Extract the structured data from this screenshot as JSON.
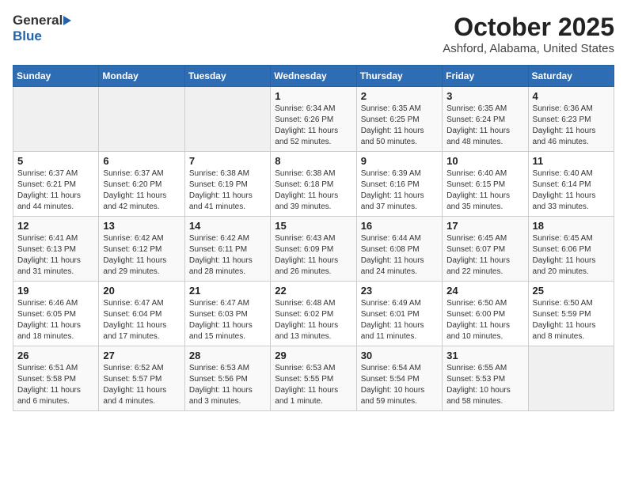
{
  "header": {
    "logo_general": "General",
    "logo_blue": "Blue",
    "month_title": "October 2025",
    "location": "Ashford, Alabama, United States"
  },
  "weekdays": [
    "Sunday",
    "Monday",
    "Tuesday",
    "Wednesday",
    "Thursday",
    "Friday",
    "Saturday"
  ],
  "weeks": [
    [
      {
        "day": "",
        "info": ""
      },
      {
        "day": "",
        "info": ""
      },
      {
        "day": "",
        "info": ""
      },
      {
        "day": "1",
        "info": "Sunrise: 6:34 AM\nSunset: 6:26 PM\nDaylight: 11 hours\nand 52 minutes."
      },
      {
        "day": "2",
        "info": "Sunrise: 6:35 AM\nSunset: 6:25 PM\nDaylight: 11 hours\nand 50 minutes."
      },
      {
        "day": "3",
        "info": "Sunrise: 6:35 AM\nSunset: 6:24 PM\nDaylight: 11 hours\nand 48 minutes."
      },
      {
        "day": "4",
        "info": "Sunrise: 6:36 AM\nSunset: 6:23 PM\nDaylight: 11 hours\nand 46 minutes."
      }
    ],
    [
      {
        "day": "5",
        "info": "Sunrise: 6:37 AM\nSunset: 6:21 PM\nDaylight: 11 hours\nand 44 minutes."
      },
      {
        "day": "6",
        "info": "Sunrise: 6:37 AM\nSunset: 6:20 PM\nDaylight: 11 hours\nand 42 minutes."
      },
      {
        "day": "7",
        "info": "Sunrise: 6:38 AM\nSunset: 6:19 PM\nDaylight: 11 hours\nand 41 minutes."
      },
      {
        "day": "8",
        "info": "Sunrise: 6:38 AM\nSunset: 6:18 PM\nDaylight: 11 hours\nand 39 minutes."
      },
      {
        "day": "9",
        "info": "Sunrise: 6:39 AM\nSunset: 6:16 PM\nDaylight: 11 hours\nand 37 minutes."
      },
      {
        "day": "10",
        "info": "Sunrise: 6:40 AM\nSunset: 6:15 PM\nDaylight: 11 hours\nand 35 minutes."
      },
      {
        "day": "11",
        "info": "Sunrise: 6:40 AM\nSunset: 6:14 PM\nDaylight: 11 hours\nand 33 minutes."
      }
    ],
    [
      {
        "day": "12",
        "info": "Sunrise: 6:41 AM\nSunset: 6:13 PM\nDaylight: 11 hours\nand 31 minutes."
      },
      {
        "day": "13",
        "info": "Sunrise: 6:42 AM\nSunset: 6:12 PM\nDaylight: 11 hours\nand 29 minutes."
      },
      {
        "day": "14",
        "info": "Sunrise: 6:42 AM\nSunset: 6:11 PM\nDaylight: 11 hours\nand 28 minutes."
      },
      {
        "day": "15",
        "info": "Sunrise: 6:43 AM\nSunset: 6:09 PM\nDaylight: 11 hours\nand 26 minutes."
      },
      {
        "day": "16",
        "info": "Sunrise: 6:44 AM\nSunset: 6:08 PM\nDaylight: 11 hours\nand 24 minutes."
      },
      {
        "day": "17",
        "info": "Sunrise: 6:45 AM\nSunset: 6:07 PM\nDaylight: 11 hours\nand 22 minutes."
      },
      {
        "day": "18",
        "info": "Sunrise: 6:45 AM\nSunset: 6:06 PM\nDaylight: 11 hours\nand 20 minutes."
      }
    ],
    [
      {
        "day": "19",
        "info": "Sunrise: 6:46 AM\nSunset: 6:05 PM\nDaylight: 11 hours\nand 18 minutes."
      },
      {
        "day": "20",
        "info": "Sunrise: 6:47 AM\nSunset: 6:04 PM\nDaylight: 11 hours\nand 17 minutes."
      },
      {
        "day": "21",
        "info": "Sunrise: 6:47 AM\nSunset: 6:03 PM\nDaylight: 11 hours\nand 15 minutes."
      },
      {
        "day": "22",
        "info": "Sunrise: 6:48 AM\nSunset: 6:02 PM\nDaylight: 11 hours\nand 13 minutes."
      },
      {
        "day": "23",
        "info": "Sunrise: 6:49 AM\nSunset: 6:01 PM\nDaylight: 11 hours\nand 11 minutes."
      },
      {
        "day": "24",
        "info": "Sunrise: 6:50 AM\nSunset: 6:00 PM\nDaylight: 11 hours\nand 10 minutes."
      },
      {
        "day": "25",
        "info": "Sunrise: 6:50 AM\nSunset: 5:59 PM\nDaylight: 11 hours\nand 8 minutes."
      }
    ],
    [
      {
        "day": "26",
        "info": "Sunrise: 6:51 AM\nSunset: 5:58 PM\nDaylight: 11 hours\nand 6 minutes."
      },
      {
        "day": "27",
        "info": "Sunrise: 6:52 AM\nSunset: 5:57 PM\nDaylight: 11 hours\nand 4 minutes."
      },
      {
        "day": "28",
        "info": "Sunrise: 6:53 AM\nSunset: 5:56 PM\nDaylight: 11 hours\nand 3 minutes."
      },
      {
        "day": "29",
        "info": "Sunrise: 6:53 AM\nSunset: 5:55 PM\nDaylight: 11 hours\nand 1 minute."
      },
      {
        "day": "30",
        "info": "Sunrise: 6:54 AM\nSunset: 5:54 PM\nDaylight: 10 hours\nand 59 minutes."
      },
      {
        "day": "31",
        "info": "Sunrise: 6:55 AM\nSunset: 5:53 PM\nDaylight: 10 hours\nand 58 minutes."
      },
      {
        "day": "",
        "info": ""
      }
    ]
  ]
}
